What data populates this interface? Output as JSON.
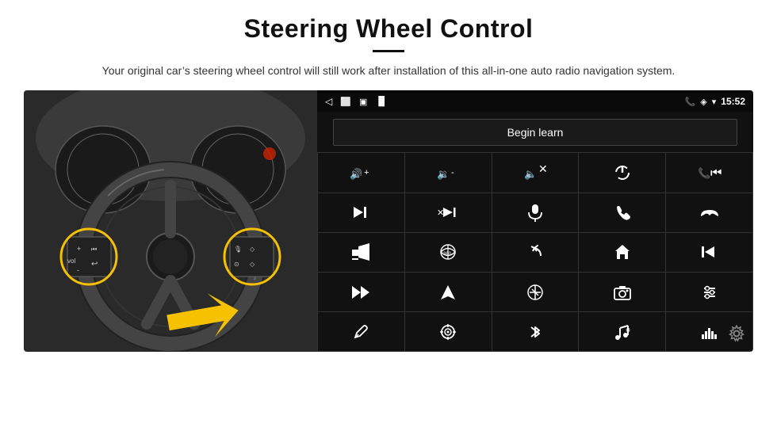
{
  "page": {
    "title": "Steering Wheel Control",
    "subtitle": "Your original car’s steering wheel control will still work after installation of this all-in-one auto radio navigation system.",
    "begin_learn_label": "Begin learn",
    "time": "15:52",
    "controls": [
      {
        "id": "vol-up",
        "icon": "🔊+",
        "unicode": ""
      },
      {
        "id": "vol-down",
        "icon": "🔉-",
        "unicode": ""
      },
      {
        "id": "mute",
        "icon": "🔇✕",
        "unicode": ""
      },
      {
        "id": "power",
        "icon": "⏻",
        "unicode": "⏻"
      },
      {
        "id": "prev-track-call",
        "icon": "📞⏮",
        "unicode": ""
      },
      {
        "id": "next-track",
        "icon": "⏭",
        "unicode": "⏭"
      },
      {
        "id": "shuffle",
        "icon": "⇌⏭",
        "unicode": ""
      },
      {
        "id": "mic",
        "icon": "🎙",
        "unicode": "🎙"
      },
      {
        "id": "phone",
        "icon": "📞",
        "unicode": "📞"
      },
      {
        "id": "hang-up",
        "icon": "📵",
        "unicode": ""
      },
      {
        "id": "horn",
        "icon": "📣",
        "unicode": "📣"
      },
      {
        "id": "360",
        "icon": "360°",
        "unicode": ""
      },
      {
        "id": "back",
        "icon": "↩",
        "unicode": "↩"
      },
      {
        "id": "home",
        "icon": "⌂",
        "unicode": "⌂"
      },
      {
        "id": "skip-back",
        "icon": "⏮⏮",
        "unicode": ""
      },
      {
        "id": "fast-fwd",
        "icon": "⏩",
        "unicode": "⏩"
      },
      {
        "id": "nav",
        "icon": "▷",
        "unicode": "▷"
      },
      {
        "id": "eq",
        "icon": "⇌",
        "unicode": ""
      },
      {
        "id": "camera",
        "icon": "📷",
        "unicode": "📷"
      },
      {
        "id": "equalizer",
        "icon": "⚙",
        "unicode": "⚙"
      },
      {
        "id": "pen",
        "icon": "✏",
        "unicode": "✏"
      },
      {
        "id": "target",
        "icon": "⊙",
        "unicode": "⊙"
      },
      {
        "id": "bluetooth",
        "icon": "⚡",
        "unicode": ""
      },
      {
        "id": "music",
        "icon": "♪",
        "unicode": "♪"
      },
      {
        "id": "spectrum",
        "icon": "▊▌▎",
        "unicode": ""
      }
    ],
    "gear_icon": "⚙"
  }
}
